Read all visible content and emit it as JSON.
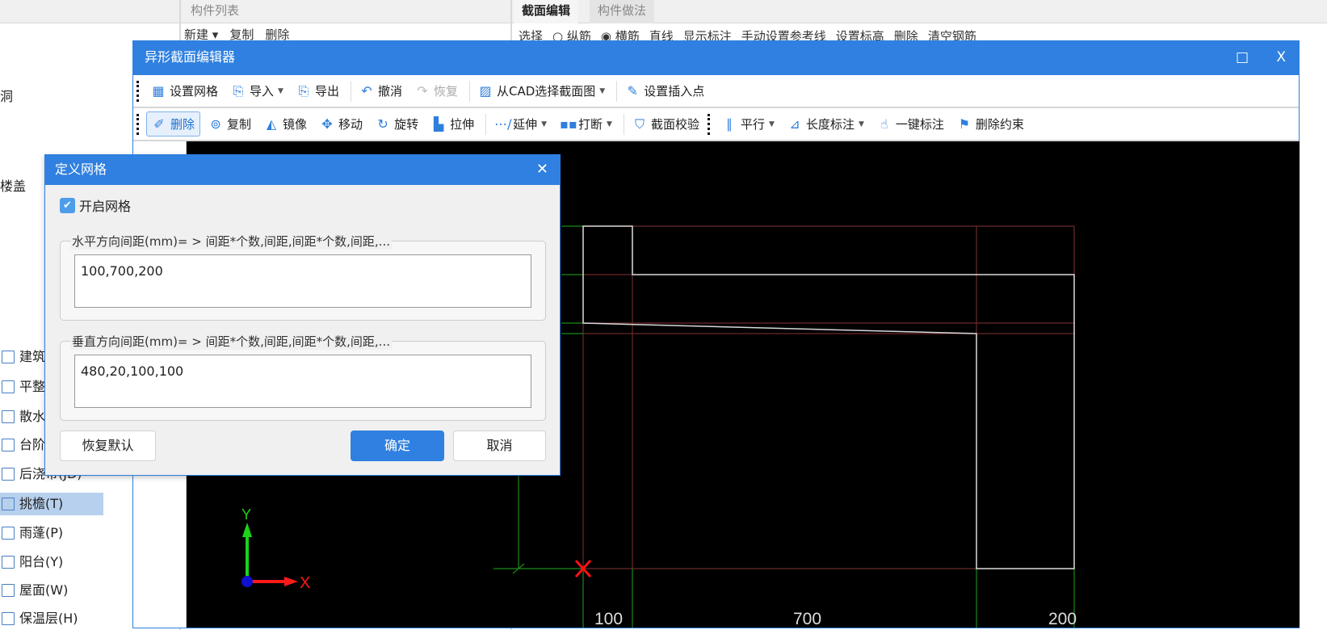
{
  "background": {
    "panel_list_title": "构件列表",
    "tabs": [
      {
        "label": "截面编辑",
        "active": true
      },
      {
        "label": "构件做法",
        "active": false
      }
    ],
    "list_toolbar": [
      "新建 ▾",
      "复制",
      "删除"
    ],
    "edit_toolbar": [
      "选择",
      "○ 纵筋",
      "◉ 横筋",
      "直线",
      "显示标注",
      "手动设置参考线",
      "设置标高",
      "删除",
      "清空钢筋"
    ],
    "left_partial_labels": [
      "洞",
      "楼盖"
    ],
    "left_items": [
      {
        "label": "建筑",
        "icon": "building-icon"
      },
      {
        "label": "平整",
        "icon": "leveling-icon"
      },
      {
        "label": "散水",
        "icon": "apron-icon"
      },
      {
        "label": "台阶",
        "icon": "steps-icon"
      },
      {
        "label": "后浇带(JD)",
        "icon": "post-cast-strip-icon"
      },
      {
        "label": "挑檐(T)",
        "icon": "cornice-icon",
        "selected": true
      },
      {
        "label": "雨蓬(P)",
        "icon": "canopy-icon"
      },
      {
        "label": "阳台(Y)",
        "icon": "balcony-icon"
      },
      {
        "label": "屋面(W)",
        "icon": "roof-icon"
      },
      {
        "label": "保温层(H)",
        "icon": "insulation-icon"
      }
    ]
  },
  "editor": {
    "title": "异形截面编辑器",
    "maximize": "□",
    "close": "X",
    "toolbar1": [
      {
        "label": "设置网格",
        "icon": "grid-icon",
        "glyph": "▦"
      },
      {
        "label": "导入",
        "icon": "import-icon",
        "glyph": "⎘",
        "caret": true
      },
      {
        "label": "导出",
        "icon": "export-icon",
        "glyph": "⎘"
      },
      {
        "sep": true
      },
      {
        "label": "撤消",
        "icon": "undo-icon",
        "glyph": "↶"
      },
      {
        "label": "恢复",
        "icon": "redo-icon",
        "glyph": "↷",
        "disabled": true
      },
      {
        "sep": true
      },
      {
        "label": "从CAD选择截面图",
        "icon": "cad-select-icon",
        "glyph": "▨",
        "caret": true
      },
      {
        "sep": true
      },
      {
        "label": "设置插入点",
        "icon": "insert-point-icon",
        "glyph": "✎"
      }
    ],
    "toolbar2": [
      {
        "label": "删除",
        "icon": "eraser-icon",
        "glyph": "✐",
        "active": true
      },
      {
        "label": "复制",
        "icon": "copy-icon",
        "glyph": "⊚"
      },
      {
        "label": "镜像",
        "icon": "mirror-icon",
        "glyph": "◭"
      },
      {
        "label": "移动",
        "icon": "move-icon",
        "glyph": "✥"
      },
      {
        "label": "旋转",
        "icon": "rotate-icon",
        "glyph": "↻"
      },
      {
        "label": "拉伸",
        "icon": "stretch-icon",
        "glyph": "▙"
      },
      {
        "sep": true
      },
      {
        "label": "延伸",
        "icon": "extend-icon",
        "glyph": "⋯/",
        "caret": true
      },
      {
        "label": "打断",
        "icon": "break-icon",
        "glyph": "▪▪",
        "caret": true
      },
      {
        "sep": true
      },
      {
        "label": "截面校验",
        "icon": "shield-check-icon",
        "glyph": "⛉"
      },
      {
        "grip": true
      },
      {
        "label": "平行",
        "icon": "parallel-icon",
        "glyph": "∥",
        "caret": true
      },
      {
        "label": "长度标注",
        "icon": "length-dimension-icon",
        "glyph": "⊿",
        "caret": true
      },
      {
        "label": "一键标注",
        "icon": "one-click-dimension-icon",
        "glyph": "☝"
      },
      {
        "label": "删除约束",
        "icon": "delete-constraint-icon",
        "glyph": "⚑"
      }
    ],
    "canvas": {
      "dim_labels": [
        "100",
        "700",
        "200"
      ],
      "axis_x": "X",
      "axis_y": "Y",
      "colors": {
        "grid": "#6b2a2a",
        "outline": "#d8d8d8",
        "guide": "#1a8a1a",
        "origin": "#ff1010"
      }
    }
  },
  "grid_dialog": {
    "title": "定义网格",
    "close": "✕",
    "enable_label": "开启网格",
    "enable_checked": true,
    "horizontal_label": "水平方向间距(mm)= >  间距*个数,间距,间距*个数,间距,...",
    "horizontal_value": "100,700,200",
    "vertical_label": "垂直方向间距(mm)= >  间距*个数,间距,间距*个数,间距,...",
    "vertical_value": "480,20,100,100",
    "reset_label": "恢复默认",
    "ok_label": "确定",
    "cancel_label": "取消",
    "accent": "#2f80e0"
  }
}
